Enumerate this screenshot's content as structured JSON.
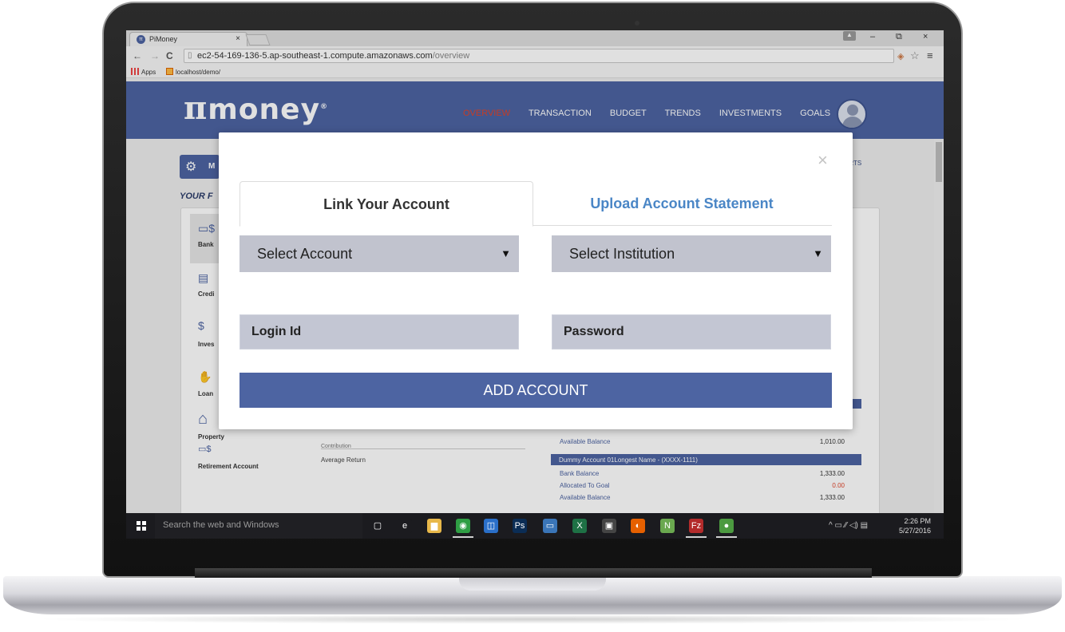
{
  "browser": {
    "tab_title": "PiMoney",
    "tab_close": "×",
    "url_host": "ec2-54-169-136-5.ap-southeast-1.compute.amazonaws.com",
    "url_path": "/overview",
    "bookmarks": [
      {
        "label": "Apps",
        "icon": "apps-icon"
      },
      {
        "label": "localhost/demo/",
        "icon": "localhost-icon"
      }
    ],
    "window_controls": {
      "minimize": "–",
      "restore": "⧉",
      "close": "×"
    }
  },
  "site": {
    "logo_pi": "π",
    "logo_text": "money",
    "logo_mark": "®",
    "nav": [
      {
        "label": "OVERVIEW",
        "active": true
      },
      {
        "label": "TRANSACTION",
        "active": false
      },
      {
        "label": "BUDGET",
        "active": false
      },
      {
        "label": "TRENDS",
        "active": false
      },
      {
        "label": "INVESTMENTS",
        "active": false
      },
      {
        "label": "GOALS",
        "active": false
      }
    ],
    "brand_color": "#4d64a2",
    "active_color": "#e0452b"
  },
  "background": {
    "menu_button": "M",
    "your_label": "YOUR F",
    "alerts_text": "ERTS",
    "sidebar": [
      {
        "label": "Bank",
        "icon": "cash-icon"
      },
      {
        "label": "Credi",
        "icon": "credit-card-icon"
      },
      {
        "label": "Inves",
        "icon": "dollar-plant-icon"
      },
      {
        "label": "Loan",
        "icon": "hand-coin-icon"
      },
      {
        "label": "Property",
        "icon": "house-icon"
      },
      {
        "label": "Retirement Account",
        "icon": "cash-icon"
      }
    ],
    "middle": [
      {
        "label": "Contribution"
      },
      {
        "label": "Average Return"
      }
    ],
    "accounts": {
      "first_available_label": "Available Balance",
      "first_available_value": "1,010.00",
      "dummy_name": "Dummy Account 01Longest Name - (XXXX-1111)",
      "rows": [
        {
          "label": "Bank Balance",
          "value": "1,333.00",
          "red": false
        },
        {
          "label": "Allocated To Goal",
          "value": "0.00",
          "red": true
        },
        {
          "label": "Available Balance",
          "value": "1,333.00",
          "red": false
        }
      ]
    }
  },
  "modal": {
    "close": "×",
    "tabs": [
      {
        "label": "Link Your Account",
        "active": true
      },
      {
        "label": "Upload Account Statement",
        "active": false
      }
    ],
    "select_account": "Select Account",
    "select_institution": "Select Institution",
    "dropdown_arrow": "▼",
    "login_placeholder": "Login Id",
    "password_placeholder": "Password",
    "add_button": "ADD ACCOUNT",
    "tab_inactive_color": "#4a86c6"
  },
  "taskbar": {
    "search_placeholder": "Search the web and Windows",
    "time": "2:26 PM",
    "date": "5/27/2016",
    "tray": "^ ▭ ⁄⁄ ◁) ▤",
    "apps": [
      {
        "name": "task-view-icon",
        "glyph": "▢",
        "color": "#1b1b1f"
      },
      {
        "name": "edge-icon",
        "glyph": "e",
        "color": "#1b1b1f"
      },
      {
        "name": "file-explorer-icon",
        "glyph": "▆",
        "color": "#e8b84a"
      },
      {
        "name": "chrome-icon",
        "glyph": "◉",
        "color": "#2f9e44"
      },
      {
        "name": "outlook-icon",
        "glyph": "◫",
        "color": "#2a6fc9"
      },
      {
        "name": "photoshop-icon",
        "glyph": "Ps",
        "color": "#0b2d55"
      },
      {
        "name": "network-icon",
        "glyph": "▭",
        "color": "#3a75b8"
      },
      {
        "name": "excel-icon",
        "glyph": "X",
        "color": "#1e7145"
      },
      {
        "name": "store-icon",
        "glyph": "▣",
        "color": "#444"
      },
      {
        "name": "firefox-icon",
        "glyph": "◐",
        "color": "#e66000"
      },
      {
        "name": "notepadpp-icon",
        "glyph": "N",
        "color": "#6aa84f"
      },
      {
        "name": "filezilla-icon",
        "glyph": "Fz",
        "color": "#b32b2b"
      },
      {
        "name": "app-green-icon",
        "glyph": "●",
        "color": "#4c9a40"
      }
    ]
  }
}
